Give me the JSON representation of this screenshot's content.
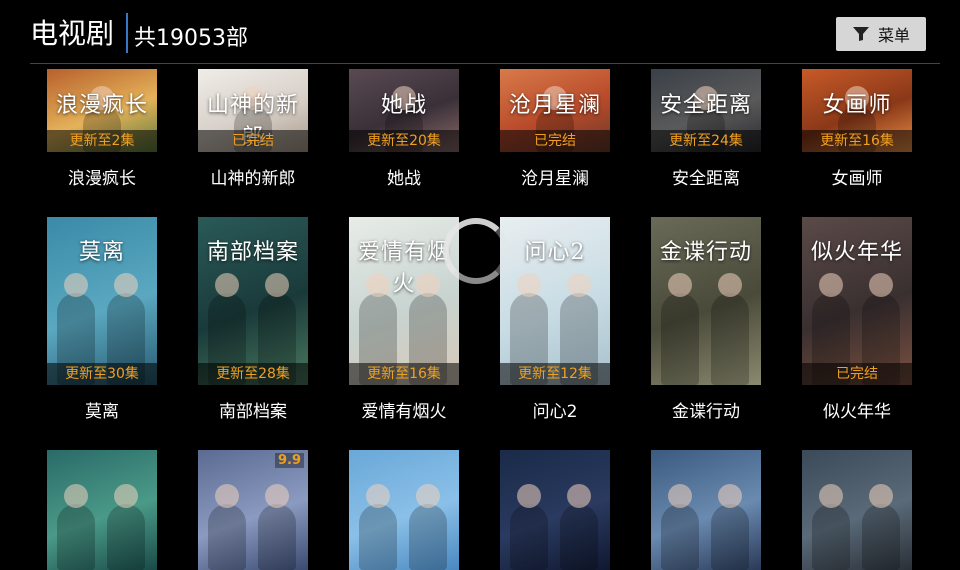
{
  "header": {
    "title": "电视剧",
    "count": "共19053部",
    "menu_label": "菜单",
    "menu_icon": "filter-icon"
  },
  "rows": [
    [
      {
        "name": "浪漫疯长",
        "badge": "更新至2集",
        "poster_text": "浪漫疯长",
        "colors": [
          "#b8602c",
          "#e4b25a",
          "#5a7a3c"
        ]
      },
      {
        "name": "山神的新郎",
        "badge": "已完结",
        "poster_text": "山神的新郎",
        "colors": [
          "#efece8",
          "#d8d0c8",
          "#a89888"
        ]
      },
      {
        "name": "她战",
        "badge": "更新至20集",
        "poster_text": "她战",
        "colors": [
          "#5a4a52",
          "#3a3038",
          "#8a6a6a"
        ]
      },
      {
        "name": "沧月星澜",
        "badge": "已完结",
        "poster_text": "沧月星澜",
        "colors": [
          "#d87a4a",
          "#b84a2a",
          "#6a3a2a"
        ]
      },
      {
        "name": "安全距离",
        "badge": "更新至24集",
        "poster_text": "安全距离",
        "colors": [
          "#3a4048",
          "#5a5a5a",
          "#2a2a30"
        ]
      },
      {
        "name": "女画师",
        "badge": "更新至16集",
        "poster_text": "女画师",
        "colors": [
          "#c85a28",
          "#8a3818",
          "#e89048"
        ]
      }
    ],
    [
      {
        "name": "莫离",
        "badge": "更新至30集",
        "poster_text": "莫离",
        "colors": [
          "#3a8aa8",
          "#5aa8c0",
          "#285a70"
        ]
      },
      {
        "name": "南部档案",
        "badge": "更新至28集",
        "poster_text": "南部档案",
        "colors": [
          "#2a5a58",
          "#1a3a3a",
          "#4a7a60"
        ]
      },
      {
        "name": "爱情有烟火",
        "badge": "更新至16集",
        "poster_text": "爱情有烟火",
        "colors": [
          "#e8ece8",
          "#c8d4d0",
          "#d8c8b8"
        ]
      },
      {
        "name": "问心2",
        "badge": "更新至12集",
        "poster_text": "问心2",
        "colors": [
          "#e8eef0",
          "#c8dce4",
          "#a8c0cc"
        ]
      },
      {
        "name": "金谍行动",
        "badge": "",
        "poster_text": "金谍行动",
        "colors": [
          "#6a6a58",
          "#4a4a3a",
          "#8a8a70"
        ]
      },
      {
        "name": "似火年华",
        "badge": "已完结",
        "poster_text": "似火年华",
        "colors": [
          "#5a4a48",
          "#3a3030",
          "#7a5040"
        ]
      }
    ],
    [
      {
        "name": "",
        "badge": "",
        "poster_text": "",
        "colors": [
          "#2a6a68",
          "#4a9a88",
          "#1a4a48"
        ]
      },
      {
        "name": "",
        "badge": "",
        "poster_text": "",
        "score": "9.9",
        "colors": [
          "#5a6a90",
          "#8a9ac0",
          "#3a4a70"
        ]
      },
      {
        "name": "",
        "badge": "",
        "poster_text": "",
        "colors": [
          "#6aa8d8",
          "#8ac0e8",
          "#4a88c0"
        ]
      },
      {
        "name": "",
        "badge": "",
        "poster_text": "",
        "colors": [
          "#1a2a48",
          "#2a3a60",
          "#101830"
        ]
      },
      {
        "name": "",
        "badge": "",
        "poster_text": "",
        "colors": [
          "#3a5a80",
          "#6a8ab0",
          "#2a3a58"
        ]
      },
      {
        "name": "",
        "badge": "",
        "poster_text": "",
        "colors": [
          "#3a4a58",
          "#5a6a78",
          "#2a3038"
        ]
      }
    ]
  ],
  "loading": {
    "icon": "loading-spinner-icon"
  }
}
